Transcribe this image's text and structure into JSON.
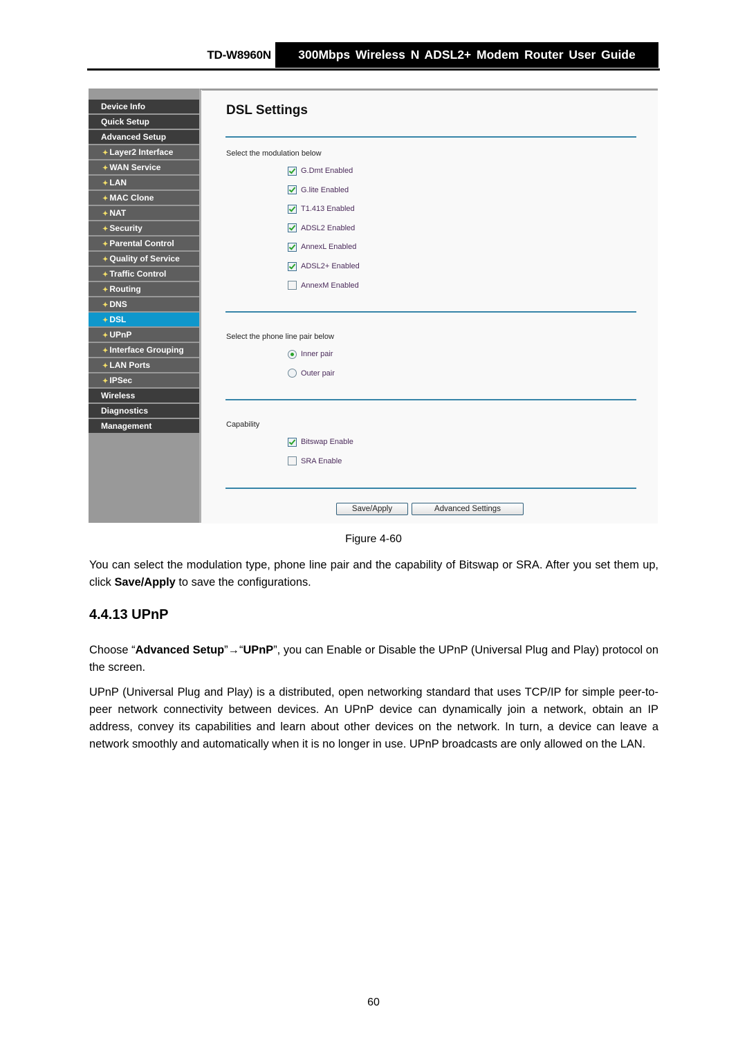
{
  "header": {
    "model": "TD-W8960N",
    "title": "300Mbps Wireless N ADSL2+ Modem Router User Guide"
  },
  "router_ui": {
    "sidebar": {
      "items": [
        {
          "label": "Device Info",
          "level": "top",
          "active": false
        },
        {
          "label": "Quick Setup",
          "level": "top",
          "active": false
        },
        {
          "label": "Advanced Setup",
          "level": "top",
          "active": false
        },
        {
          "label": "Layer2 Interface",
          "level": "sub",
          "active": false
        },
        {
          "label": "WAN Service",
          "level": "sub",
          "active": false
        },
        {
          "label": "LAN",
          "level": "sub",
          "active": false
        },
        {
          "label": "MAC Clone",
          "level": "sub",
          "active": false
        },
        {
          "label": "NAT",
          "level": "sub",
          "active": false
        },
        {
          "label": "Security",
          "level": "sub",
          "active": false
        },
        {
          "label": "Parental Control",
          "level": "sub",
          "active": false
        },
        {
          "label": "Quality of Service",
          "level": "sub",
          "active": false
        },
        {
          "label": "Traffic Control",
          "level": "sub",
          "active": false
        },
        {
          "label": "Routing",
          "level": "sub",
          "active": false
        },
        {
          "label": "DNS",
          "level": "sub",
          "active": false
        },
        {
          "label": "DSL",
          "level": "sub",
          "active": true
        },
        {
          "label": "UPnP",
          "level": "sub",
          "active": false
        },
        {
          "label": "Interface Grouping",
          "level": "sub",
          "active": false
        },
        {
          "label": "LAN Ports",
          "level": "sub",
          "active": false
        },
        {
          "label": "IPSec",
          "level": "sub",
          "active": false
        },
        {
          "label": "Wireless",
          "level": "top",
          "active": false
        },
        {
          "label": "Diagnostics",
          "level": "top",
          "active": false
        },
        {
          "label": "Management",
          "level": "top",
          "active": false
        }
      ]
    },
    "page_title": "DSL Settings",
    "modulation": {
      "label": "Select the modulation below",
      "options": [
        {
          "label": "G.Dmt Enabled",
          "checked": true
        },
        {
          "label": "G.lite Enabled",
          "checked": true
        },
        {
          "label": "T1.413 Enabled",
          "checked": true
        },
        {
          "label": "ADSL2 Enabled",
          "checked": true
        },
        {
          "label": "AnnexL Enabled",
          "checked": true
        },
        {
          "label": "ADSL2+ Enabled",
          "checked": true
        },
        {
          "label": "AnnexM Enabled",
          "checked": false
        }
      ]
    },
    "phone_pair": {
      "label": "Select the phone line pair below",
      "options": [
        {
          "label": "Inner pair",
          "selected": true
        },
        {
          "label": "Outer pair",
          "selected": false
        }
      ]
    },
    "capability": {
      "label": "Capability",
      "options": [
        {
          "label": "Bitswap Enable",
          "checked": true
        },
        {
          "label": "SRA Enable",
          "checked": false
        }
      ]
    },
    "buttons": {
      "save_apply": "Save/Apply",
      "advanced_settings": "Advanced Settings"
    },
    "colors": {
      "nav_top": "#3c3c3c",
      "nav_sub": "#5e5e5e",
      "nav_active": "#0f97cc",
      "rule": "#3684a8",
      "check": "#2aa32a"
    }
  },
  "doc": {
    "figure_caption": "Figure 4-60",
    "para1_a": "You can select the modulation type, phone line pair and the capability of Bitswap or SRA. After you set them up, click ",
    "para1_bold": "Save/Apply",
    "para1_b": " to save the configurations.",
    "section_heading": "4.4.13 UPnP",
    "para2_a": "Choose “",
    "para2_bold1": "Advanced Setup",
    "para2_arrow": "”→“",
    "para2_bold2": "UPnP",
    "para2_b": "”, you can Enable or Disable the UPnP (Universal Plug and Play) protocol on the screen.",
    "para3": "UPnP (Universal Plug and Play) is a distributed, open networking standard that uses TCP/IP for simple peer-to-peer network connectivity between devices. An UPnP device can dynamically join a network, obtain an IP address, convey its capabilities and learn about other devices on the network. In turn, a device can leave a network smoothly and automatically when it is no longer in use. UPnP broadcasts are only allowed on the LAN.",
    "page_number": "60"
  }
}
